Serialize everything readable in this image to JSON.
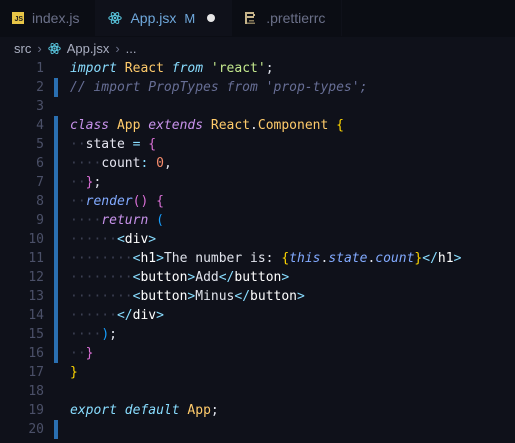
{
  "tabs": [
    {
      "label": "index.js",
      "icon": "js-icon",
      "active": false
    },
    {
      "label": "App.jsx",
      "icon": "react-icon",
      "active": true,
      "status": "M"
    },
    {
      "label": ".prettierrc",
      "icon": "prettier-icon",
      "active": false
    }
  ],
  "breadcrumb": {
    "folder": "src",
    "file": "App.jsx",
    "trail": "..."
  },
  "colors": {
    "accent": "#6fa8dc",
    "background": "#0f111a",
    "modified_gutter": "#2a6fb1"
  },
  "lines": [
    {
      "n": "1"
    },
    {
      "n": "2"
    },
    {
      "n": "3"
    },
    {
      "n": "4"
    },
    {
      "n": "5"
    },
    {
      "n": "6"
    },
    {
      "n": "7"
    },
    {
      "n": "8"
    },
    {
      "n": "9"
    },
    {
      "n": "10"
    },
    {
      "n": "11"
    },
    {
      "n": "12"
    },
    {
      "n": "13"
    },
    {
      "n": "14"
    },
    {
      "n": "15"
    },
    {
      "n": "16"
    },
    {
      "n": "17"
    },
    {
      "n": "18"
    },
    {
      "n": "19"
    },
    {
      "n": "20"
    }
  ],
  "code": {
    "l1": {
      "import": "import",
      "react": "React",
      "from": "from",
      "module": "'react'",
      "semi": ";"
    },
    "l2": {
      "comment": "// import PropTypes from 'prop-types';"
    },
    "l4": {
      "class": "class",
      "name": "App",
      "extends": "extends",
      "react": "React",
      "dot": ".",
      "component": "Component",
      "brace": "{"
    },
    "l5": {
      "state": "state",
      "eq": " = ",
      "brace": "{"
    },
    "l6": {
      "key": "count",
      "colon": ": ",
      "value": "0",
      "comma": ","
    },
    "l7": {
      "brace": "}",
      "semi": ";"
    },
    "l8": {
      "render": "render",
      "parens": "()",
      "brace": "{"
    },
    "l9": {
      "return": "return",
      "paren": "("
    },
    "l10": {
      "tag": "div"
    },
    "l11": {
      "tag": "h1",
      "text": "The number is: ",
      "this": "this",
      "state": "state",
      "count": "count"
    },
    "l12": {
      "tag": "button",
      "text": "Add"
    },
    "l13": {
      "tag": "button",
      "text": "Minus"
    },
    "l14": {
      "tag": "div"
    },
    "l15": {
      "paren": ")",
      "semi": ";"
    },
    "l16": {
      "brace": "}"
    },
    "l17": {
      "brace": "}"
    },
    "l19": {
      "export": "export",
      "default": "default",
      "name": "App",
      "semi": ";"
    }
  }
}
